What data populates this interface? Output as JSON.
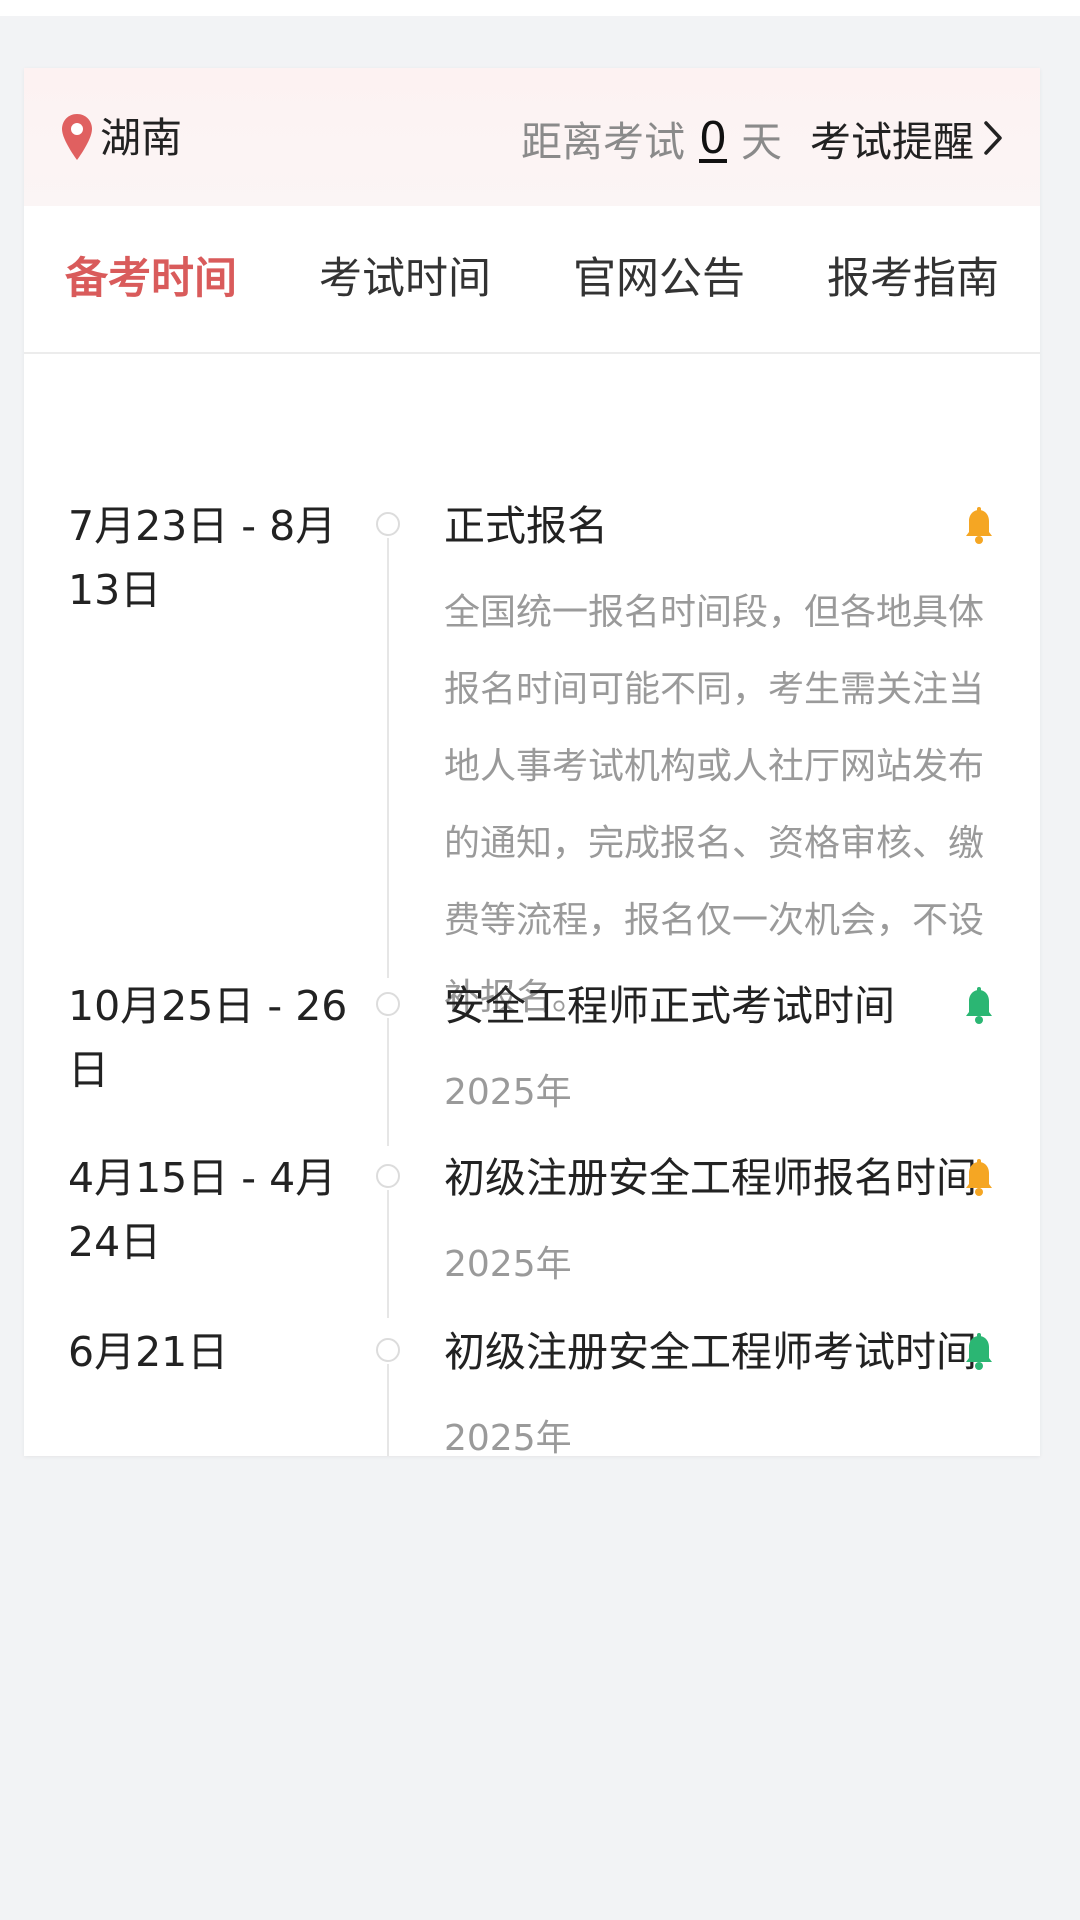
{
  "header": {
    "location": "湖南",
    "countdown_prefix": "距离考试",
    "countdown_days": "0",
    "countdown_suffix": "天",
    "reminder_label": "考试提醒"
  },
  "tabs": [
    {
      "label": "备考时间",
      "active": true
    },
    {
      "label": "考试时间",
      "active": false
    },
    {
      "label": "官网公告",
      "active": false
    },
    {
      "label": "报考指南",
      "active": false
    }
  ],
  "timeline": [
    {
      "date": "7月23日 - 8月13日",
      "title": "正式报名",
      "desc": "全国统一报名时间段，但各地具体报名时间可能不同，考生需关注当地人事考试机构或人社厅网站发布的通知，完成报名、资格审核、缴费等流程，报名仅一次机会，不设补报名。",
      "bell_color": "#f5a623"
    },
    {
      "date": "10月25日 - 26日",
      "title": "安全工程师正式考试时间",
      "desc": "2025年",
      "bell_color": "#2bb673"
    },
    {
      "date": "4月15日 - 4月24日",
      "title": "初级注册安全工程师报名时间",
      "desc": "2025年",
      "bell_color": "#f5a623"
    },
    {
      "date": "6月21日",
      "title": "初级注册安全工程师考试时间",
      "desc": "2025年",
      "bell_color": "#2bb673"
    }
  ],
  "colors": {
    "accent": "#d95b5b",
    "pin": "#e06060"
  },
  "icons": {
    "location": "map-pin-icon",
    "chevron": "chevron-right-icon",
    "bell": "bell-icon"
  }
}
